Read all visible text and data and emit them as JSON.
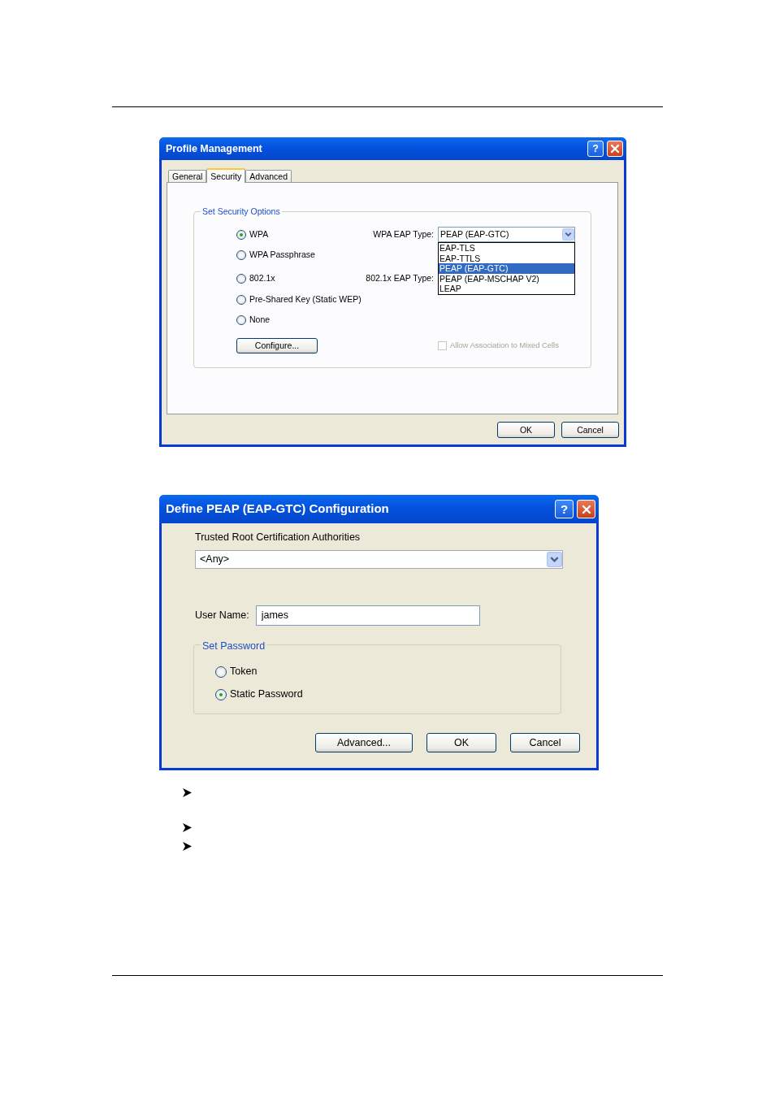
{
  "profile_dialog": {
    "title": "Profile Management",
    "help_button": "?",
    "tabs": [
      {
        "label": "General",
        "selected": false
      },
      {
        "label": "Security",
        "selected": true
      },
      {
        "label": "Advanced",
        "selected": false
      }
    ],
    "group_title": "Set Security Options",
    "options": [
      {
        "label": "WPA",
        "selected": true,
        "side_label": "WPA EAP Type:"
      },
      {
        "label": "WPA Passphrase",
        "selected": false
      },
      {
        "label": "802.1x",
        "selected": false,
        "side_label": "802.1x EAP Type:"
      },
      {
        "label": "Pre-Shared Key (Static WEP)",
        "selected": false
      },
      {
        "label": "None",
        "selected": false
      }
    ],
    "eap_select": {
      "value": "PEAP (EAP-GTC)",
      "expanded": true,
      "options": [
        {
          "label": "EAP-TLS",
          "selected": false
        },
        {
          "label": "EAP-TTLS",
          "selected": false
        },
        {
          "label": "PEAP (EAP-GTC)",
          "selected": true
        },
        {
          "label": "PEAP (EAP-MSCHAP V2)",
          "selected": false
        },
        {
          "label": "LEAP",
          "selected": false
        }
      ]
    },
    "configure_button": "Configure...",
    "mixed_cells": {
      "label": "Allow Association to Mixed Cells",
      "checked": false,
      "disabled": true
    },
    "buttons": [
      "OK",
      "Cancel"
    ]
  },
  "peap_dialog": {
    "title": "Define PEAP (EAP-GTC) Configuration",
    "help_button": "?",
    "ca_label": "Trusted Root Certification Authorities",
    "ca_select": {
      "value": "<Any>"
    },
    "username_label": "User Name:",
    "username_value": "james",
    "password_group": {
      "title": "Set Password",
      "options": [
        {
          "label": "Token",
          "selected": false
        },
        {
          "label": "Static Password",
          "selected": true
        }
      ]
    },
    "buttons": [
      "Advanced...",
      "OK",
      "Cancel"
    ]
  }
}
